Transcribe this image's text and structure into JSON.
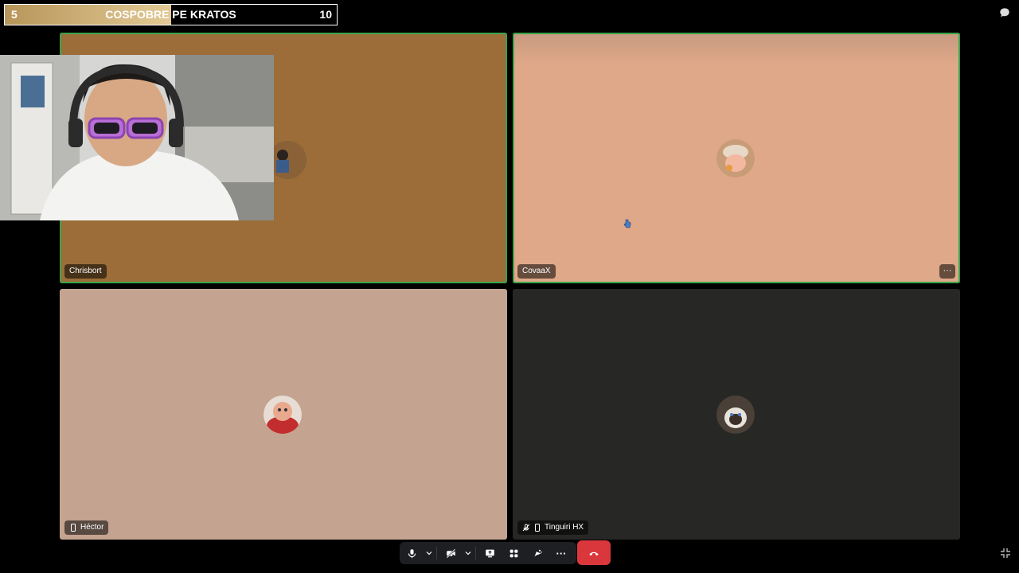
{
  "scorebar": {
    "left_value": "5",
    "title": "COSPOBRE PE KRATOS",
    "right_value": "10",
    "progress_fraction": 0.5
  },
  "tiles": [
    {
      "name": "Chrisbort",
      "bg": "#9c6d38",
      "speaking": true
    },
    {
      "name": "CovaaX",
      "bg": "#dfa888",
      "speaking": true,
      "more_label": "···"
    },
    {
      "name": "Héctor",
      "bg": "#c4a390",
      "speaking": false
    },
    {
      "name": "Tinguiri HX",
      "bg": "#272825",
      "speaking": false
    }
  ],
  "controls": {
    "icons": [
      "microphone-icon",
      "chevron-down-icon",
      "camera-off-icon",
      "chevron-down-icon",
      "screen-share-icon",
      "activities-icon",
      "soundboard-icon",
      "more-icon"
    ],
    "more_label": "···",
    "hangup": "hang-up-icon",
    "hangup_color": "#da373c"
  }
}
